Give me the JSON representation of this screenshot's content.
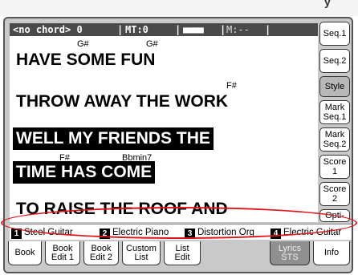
{
  "top_fragment": "y",
  "status_bar": {
    "chord": "<no chord> 0",
    "sep": "|",
    "mt": "MT:0",
    "meter": "■■■■",
    "m": "M:--"
  },
  "lyrics": {
    "lines": [
      "HAVE SOME FUN",
      "THROW AWAY THE WORK",
      "WELL MY FRIENDS THE",
      "TIME HAS COME",
      "TO RAISE THE ROOF AND"
    ],
    "chords": [
      "G#",
      "G#",
      "F#",
      "F#",
      "Bbmin7"
    ]
  },
  "right_tabs": [
    {
      "label": "Seq.1"
    },
    {
      "label": "Seq.2"
    },
    {
      "label": "Style"
    },
    {
      "label": "Mark\nSeq.1"
    },
    {
      "label": "Mark\nSeq.2"
    },
    {
      "label": "Score\n1"
    },
    {
      "label": "Score\n2"
    },
    {
      "label": "Opti-\nons"
    }
  ],
  "tracks": [
    {
      "num": "1",
      "name": "Steel Guitar"
    },
    {
      "num": "2",
      "name": "Electric Piano"
    },
    {
      "num": "3",
      "name": "Distortion Org"
    },
    {
      "num": "4",
      "name": "Electric Guitar"
    }
  ],
  "bottom_tabs": [
    {
      "line1": "Book",
      "line2": ""
    },
    {
      "line1": "Book",
      "line2": "Edit 1"
    },
    {
      "line1": "Book",
      "line2": "Edit 2"
    },
    {
      "line1": "Custom",
      "line2": "List"
    },
    {
      "line1": "List",
      "line2": "Edit"
    },
    {
      "line1": "Lyrics",
      "line2": "STS"
    },
    {
      "line1": "Info",
      "line2": ""
    }
  ],
  "colors": {
    "annotation": "#e0151b",
    "highlight_bg": "#000000",
    "active_tab": "#b8b8b8"
  }
}
